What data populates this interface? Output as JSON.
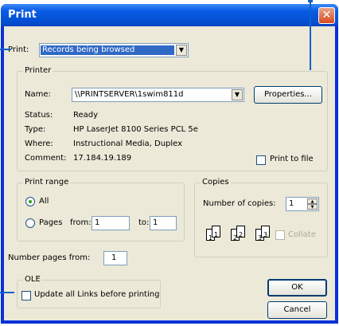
{
  "window": {
    "title": "Print",
    "close_glyph": "✕"
  },
  "print_select": {
    "label": "Print:",
    "value": "Records being browsed"
  },
  "printer": {
    "legend": "Printer",
    "name_label": "Name:",
    "name_value": "\\\\PRINTSERVER\\1swim811d",
    "properties_button": "Properties...",
    "status_label": "Status:",
    "status_value": "Ready",
    "type_label": "Type:",
    "type_value": "HP LaserJet 8100 Series PCL 5e",
    "where_label": "Where:",
    "where_value": "Instructional Media, Duplex",
    "comment_label": "Comment:",
    "comment_value": "17.184.19.189",
    "print_to_file": "Print to file"
  },
  "print_range": {
    "legend": "Print range",
    "all": "All",
    "pages": "Pages",
    "from_label": "from:",
    "from_value": "1",
    "to_label": "to:",
    "to_value": "1"
  },
  "copies": {
    "legend": "Copies",
    "number_label": "Number of copies:",
    "number_value": "1",
    "collate": "Collate",
    "pages": [
      "1",
      "1",
      "2",
      "2",
      "3",
      "3"
    ]
  },
  "number_pages": {
    "label": "Number pages from:",
    "value": "1"
  },
  "ole": {
    "legend": "OLE",
    "update_links": "Update all Links before printing"
  },
  "buttons": {
    "ok": "OK",
    "cancel": "Cancel"
  },
  "icons": {
    "dropdown": "▼",
    "spin_up": "▲",
    "spin_down": "▼"
  },
  "colors": {
    "titlebar": "#0a5ce5",
    "frame": "#0831d9",
    "callout": "#1560c9",
    "face": "#ece9d8"
  }
}
